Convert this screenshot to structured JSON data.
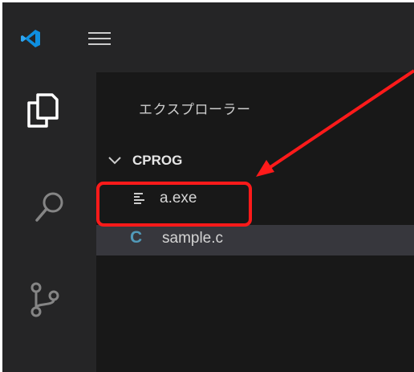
{
  "colors": {
    "editor_bg": "#181818",
    "bar_bg": "#252526",
    "selected_row": "#37373d",
    "annotation": "#ff1a1a",
    "c_file_icon": "#519aba"
  },
  "icons": {
    "logo": "vscode-logo-icon",
    "menu": "hamburger-menu-icon",
    "explorer": "files-icon",
    "search": "search-icon",
    "source_control": "source-control-icon",
    "chevron": "chevron-down-icon",
    "text_file": "text-file-icon",
    "c_file": "c-file-icon"
  },
  "sidebar": {
    "title": "エクスプローラー",
    "folder": {
      "name": "CPROG",
      "expanded": true
    },
    "files": [
      {
        "label": "a.exe",
        "icon": "text-file-icon",
        "selected": false
      },
      {
        "label": "sample.c",
        "icon_glyph": "C",
        "selected": true
      }
    ]
  }
}
